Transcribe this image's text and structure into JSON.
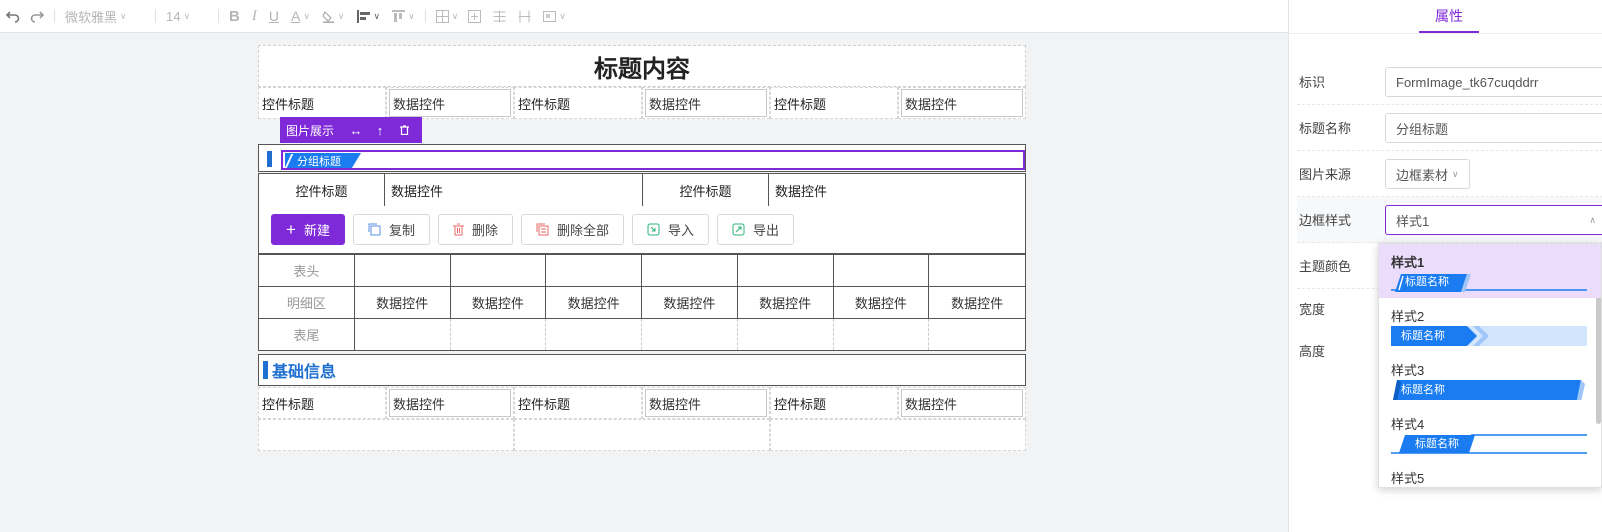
{
  "toolbar": {
    "font_family": "微软雅黑",
    "font_size": "14"
  },
  "form": {
    "title": "标题内容",
    "control_title": "控件标题",
    "data_control": "数据控件",
    "image_toolbar_label": "图片展示",
    "group_title": "分组标题",
    "buttons": {
      "new": "新建",
      "copy": "复制",
      "delete": "删除",
      "delete_all": "删除全部",
      "import": "导入",
      "export": "导出"
    },
    "grid": {
      "header": "表头",
      "detail": "明细区",
      "footer": "表尾"
    },
    "basic_info": "基础信息"
  },
  "panel": {
    "tab": "属性",
    "id_label": "标识",
    "id_value": "FormImage_tk67cuqddrr",
    "title_name_label": "标题名称",
    "title_name_value": "分组标题",
    "image_source_label": "图片来源",
    "image_source_value": "边框素材",
    "border_style_label": "边框样式",
    "border_style_value": "样式1",
    "theme_color_label": "主题颜色",
    "width_label": "宽度",
    "height_label": "高度"
  },
  "dropdown": {
    "options": [
      "样式1",
      "样式2",
      "样式3",
      "样式4",
      "样式5"
    ],
    "preview_text": "标题名称",
    "selected_index": 0
  },
  "colors": {
    "accent": "#7f2ad8",
    "blue": "#1a7cf0",
    "selected_option_bg": "#ecdcfb"
  }
}
